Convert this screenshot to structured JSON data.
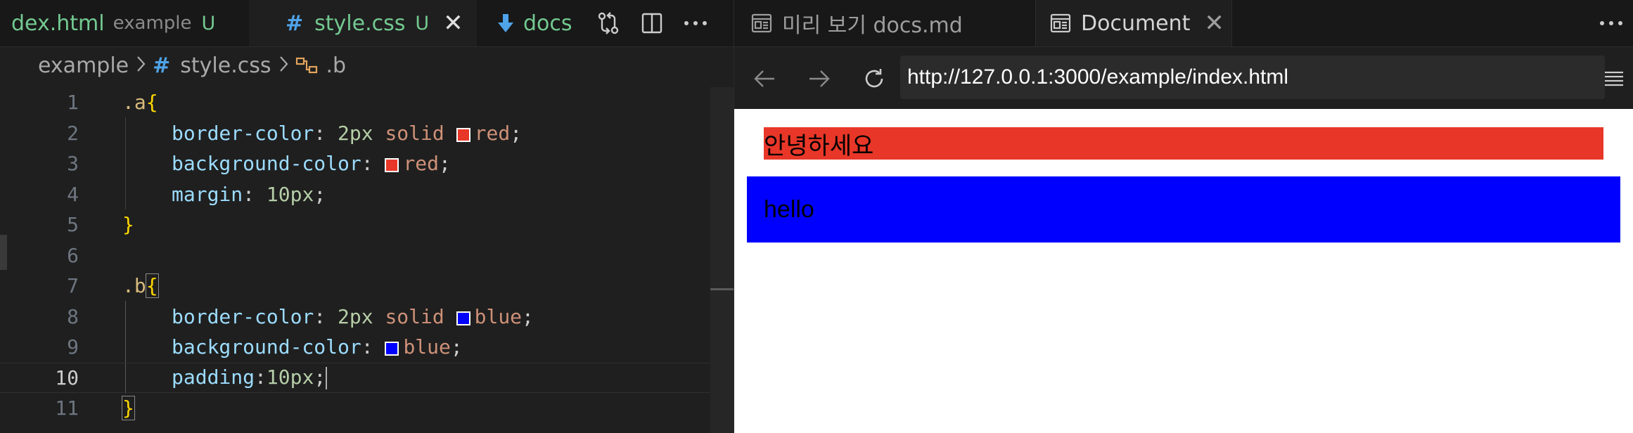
{
  "editor_tabs": [
    {
      "label": "dex.html",
      "folder": "example",
      "badge": "U"
    },
    {
      "label": "style.css",
      "badge": "U"
    },
    {
      "label": "docs"
    }
  ],
  "breadcrumb": {
    "folder": "example",
    "file": "style.css",
    "symbol": ".b"
  },
  "code_lines": [
    {
      "number": "1",
      "sel": ".a",
      "brace": "{"
    },
    {
      "number": "2",
      "prop": "border-color",
      "value_num": "2px",
      "value_kw": "solid",
      "swatch": "#e83728",
      "color_name": "red"
    },
    {
      "number": "3",
      "prop": "background-color",
      "swatch": "#e83728",
      "color_name": "red"
    },
    {
      "number": "4",
      "prop": "margin",
      "value_num": "10px"
    },
    {
      "number": "5",
      "brace": "}"
    },
    {
      "number": "6"
    },
    {
      "number": "7",
      "sel": ".b",
      "brace": "{"
    },
    {
      "number": "8",
      "prop": "border-color",
      "value_num": "2px",
      "value_kw": "solid",
      "swatch": "#0000ff",
      "color_name": "blue"
    },
    {
      "number": "9",
      "prop": "background-color",
      "swatch": "#0000ff",
      "color_name": "blue"
    },
    {
      "number": "10",
      "prop": "padding",
      "value_num": "10px"
    },
    {
      "number": "11",
      "brace": "}"
    }
  ],
  "preview_tabs": [
    {
      "label": "미리 보기 docs.md"
    },
    {
      "label": "Document"
    }
  ],
  "browser": {
    "url": "http://127.0.0.1:3000/example/index.html",
    "box_a_text": "안녕하세요",
    "box_b_text": "hello"
  },
  "colors": {
    "git_untracked": "#73c991",
    "box_a_bg": "#e83728",
    "box_b_bg": "#0000ff"
  },
  "icons": [
    "markdown-file-icon",
    "source-control-icon",
    "split-editor-icon",
    "more-actions-icon",
    "preview-icon",
    "close-icon",
    "back-arrow-icon",
    "forward-arrow-icon",
    "reload-icon",
    "menu-icon"
  ]
}
